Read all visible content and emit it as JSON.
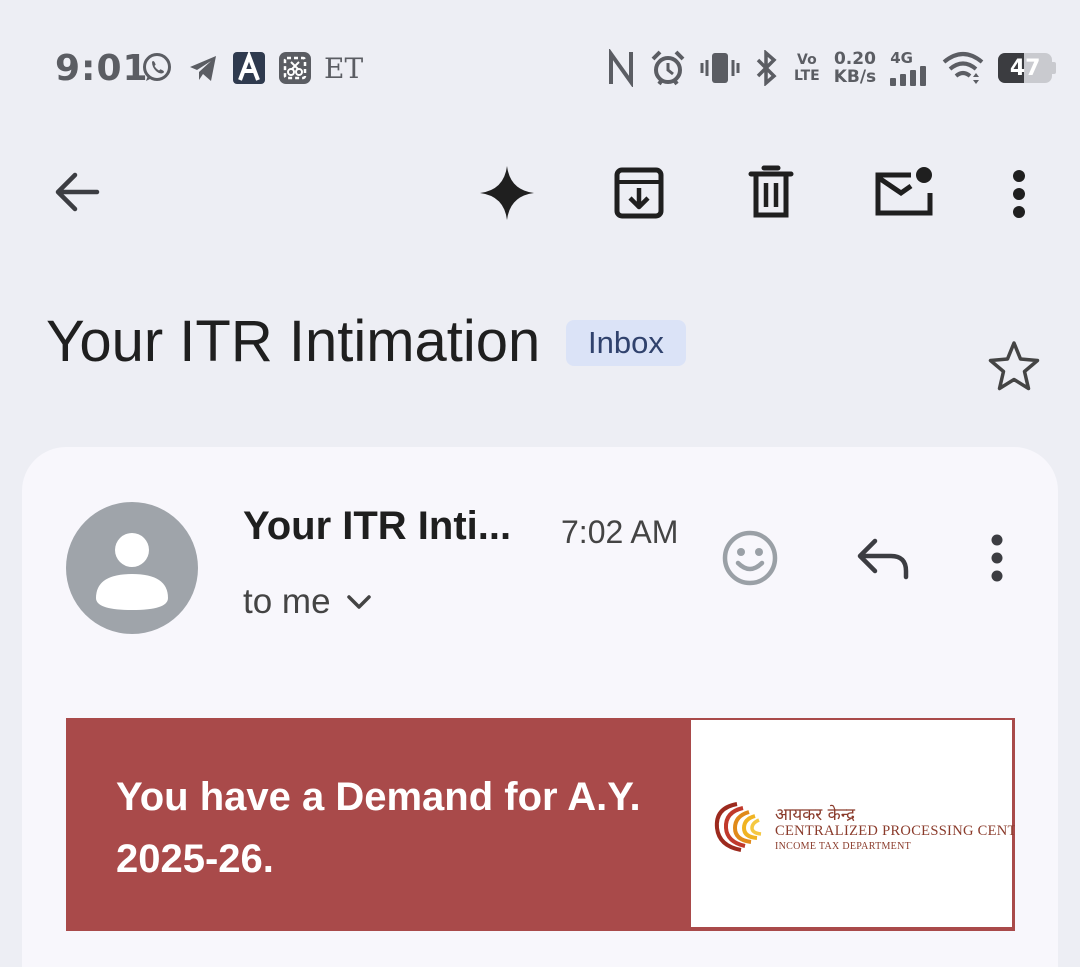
{
  "status_bar": {
    "time": "9:01",
    "left_icons": [
      "whatsapp-icon",
      "telegram-icon",
      "a-app-icon",
      "screenshot-app-icon",
      "et-icon"
    ],
    "et_label": "ET",
    "right_icons": [
      "nfc-icon",
      "alarm-icon",
      "vibrate-icon",
      "bluetooth-icon",
      "volte-icon",
      "net-speed",
      "signal-4g-icon",
      "wifi-icon",
      "battery-icon"
    ],
    "volte_top": "Vo",
    "volte_bottom": "LTE",
    "net_speed_value": "0.20",
    "net_speed_unit": "KB/s",
    "network_type": "4G",
    "battery_level": "47",
    "battery_fraction": 0.47
  },
  "toolbar": {
    "icons": [
      "back-arrow-icon",
      "gemini-sparkle-icon",
      "archive-icon",
      "delete-icon",
      "mark-unread-icon",
      "more-vert-icon"
    ]
  },
  "email": {
    "subject": "Your ITR Intimation",
    "label": "Inbox",
    "sender": "Your ITR Inti...",
    "time": "7:02 AM",
    "recipient": "to me"
  },
  "banner": {
    "text": "You have a Demand for A.Y. 2025-26.",
    "logo_hindi": "आयकर केन्द्र",
    "logo_title": "CENTRALIZED PROCESSING CENTER",
    "logo_subtitle": "INCOME TAX DEPARTMENT"
  },
  "colors": {
    "background": "#edeef4",
    "card": "#f8f7fc",
    "banner": "#a94a4a",
    "chip": "#dbe3f7",
    "avatar": "#9fa4aa"
  }
}
